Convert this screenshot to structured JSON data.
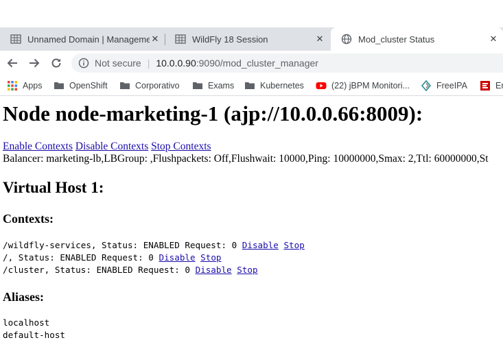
{
  "browser": {
    "tabs": [
      {
        "title": "Unnamed Domain | Manageme",
        "icon": "grid-favicon-icon",
        "close": "✕"
      },
      {
        "title": "WildFly 18 Session",
        "icon": "grid-favicon-icon",
        "close": "✕"
      },
      {
        "title": "Mod_cluster Status",
        "icon": "globe-icon",
        "close": "✕",
        "active": true
      }
    ],
    "address": {
      "security_label": "Not secure",
      "host": "10.0.0.90",
      "path": ":9090/mod_cluster_manager"
    },
    "bookmarks": [
      {
        "label": "Apps",
        "icon": "apps-grid-icon"
      },
      {
        "label": "OpenShift",
        "icon": "folder-icon"
      },
      {
        "label": "Corporativo",
        "icon": "folder-icon"
      },
      {
        "label": "Exams",
        "icon": "folder-icon"
      },
      {
        "label": "Kubernetes",
        "icon": "folder-icon"
      },
      {
        "label": "(22) jBPM Monitori...",
        "icon": "youtube-icon"
      },
      {
        "label": "FreeIPA",
        "icon": "freeipa-icon"
      },
      {
        "label": "Er",
        "icon": "red-badge-icon"
      }
    ]
  },
  "page": {
    "node_title": "Node node-marketing-1 (ajp://10.0.0.66:8009):",
    "actions": [
      "Enable Contexts",
      "Disable Contexts",
      "Stop Contexts"
    ],
    "balancer_line": "Balancer: marketing-lb,LBGroup: ,Flushpackets: Off,Flushwait: 10000,Ping: 10000000,Smax: 2,Ttl: 60000000,St",
    "virtual_host_title": "Virtual Host 1:",
    "contexts_title": "Contexts:",
    "contexts": [
      {
        "text": "/wildfly-services, Status: ENABLED Request: 0",
        "disable": "Disable",
        "stop": "Stop"
      },
      {
        "text": "/, Status: ENABLED Request: 0",
        "disable": "Disable",
        "stop": "Stop"
      },
      {
        "text": "/cluster, Status: ENABLED Request: 0",
        "disable": "Disable",
        "stop": "Stop"
      }
    ],
    "aliases_title": "Aliases:",
    "aliases": [
      "localhost",
      "default-host"
    ]
  },
  "colors": {
    "tab_strip": "#dee1e6",
    "link": "#1a0dab",
    "omnibox": "#f1f3f4"
  }
}
